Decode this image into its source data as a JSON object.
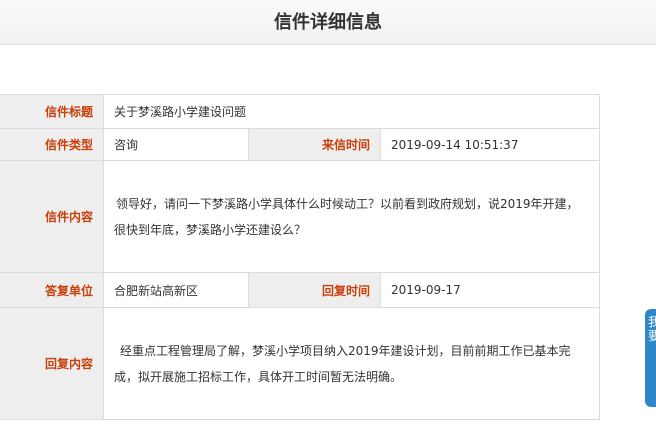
{
  "page": {
    "title": "信件详细信息"
  },
  "labels": {
    "subject": "信件标题",
    "type": "信件类型",
    "received_time": "来信时间",
    "content": "信件内容",
    "reply_unit": "答复单位",
    "reply_time": "回复时间",
    "reply_content": "回复内容"
  },
  "letter": {
    "subject": "关于梦溪路小学建设问题",
    "type": "咨询",
    "received_time": "2019-09-14 10:51:37",
    "content": "领导好，请问一下梦溪路小学具体什么时候动工？以前看到政府规划，说2019年开建，很快到年底，梦溪路小学还建设么？",
    "reply_unit": "合肥新站高新区",
    "reply_time": "2019-09-17",
    "reply_content": "经重点工程管理局了解，梦溪小学项目纳入2019年建设计划，目前前期工作已基本完成，拟开展施工招标工作，具体开工时间暂无法明确。"
  },
  "side_tab": {
    "label": "我要"
  },
  "colors": {
    "label_text": "#c8400c",
    "label_bg": "#eeeeee",
    "border": "#dcdcdc",
    "side_tab": "#2f86c9"
  }
}
